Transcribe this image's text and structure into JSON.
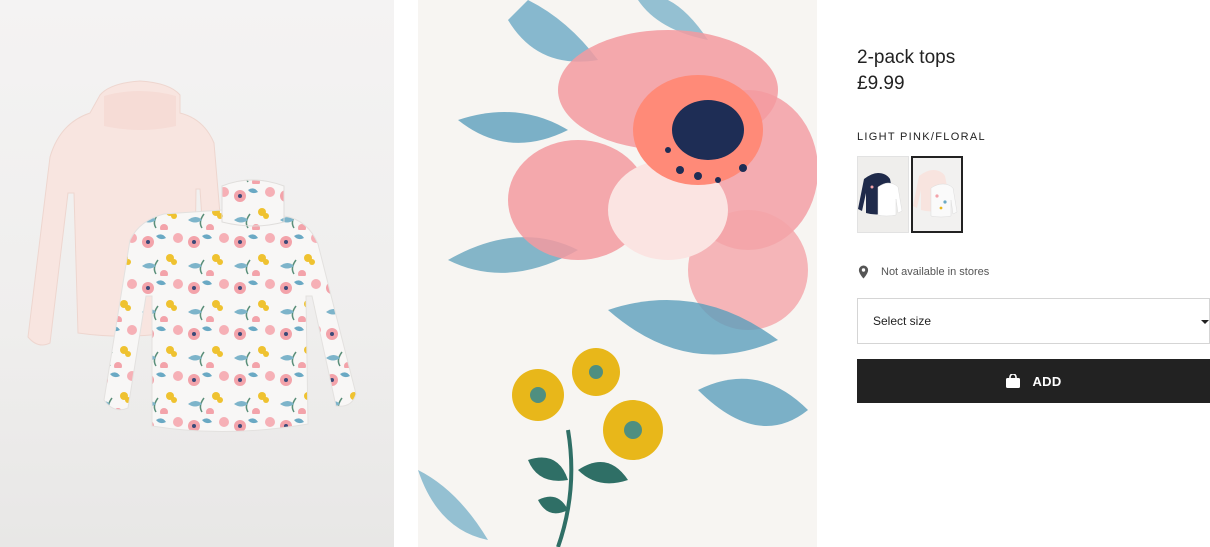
{
  "product": {
    "title": "2-pack tops",
    "price": "£9.99",
    "color_name": "LIGHT PINK/FLORAL",
    "swatches": [
      {
        "name": "dark-blue-floral",
        "selected": false
      },
      {
        "name": "light-pink-floral",
        "selected": true
      }
    ],
    "store_availability": "Not available in stores",
    "size_select_label": "Select size",
    "add_button_label": "ADD"
  },
  "icons": {
    "store": "location-pin-icon",
    "size_caret": "caret-down-icon",
    "add": "shopping-bag-icon"
  },
  "colors": {
    "button_background": "#222222",
    "button_text": "#ffffff",
    "selected_swatch_border": "#222222",
    "floral_pink": "#f08b93",
    "floral_blue": "#4f9fbd",
    "floral_yellow": "#e8b71a"
  }
}
